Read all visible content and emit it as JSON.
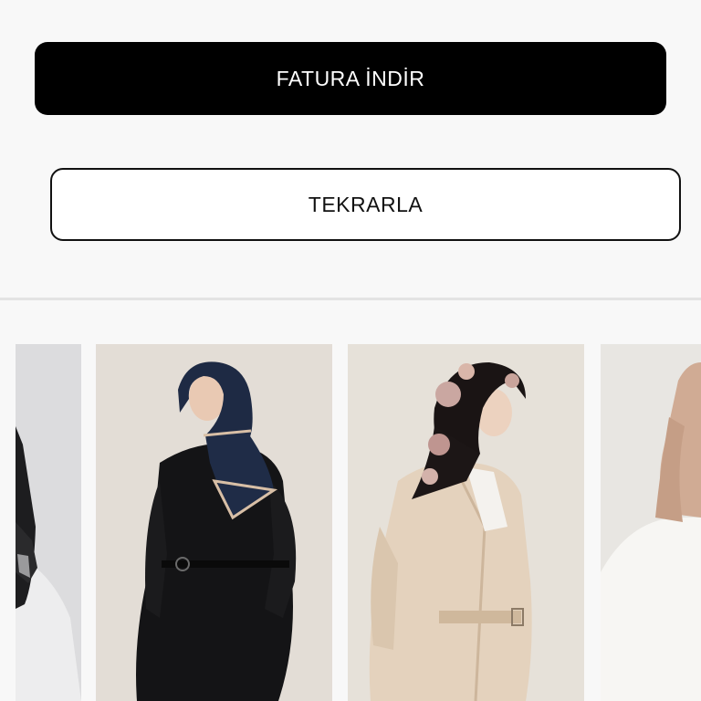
{
  "actions": {
    "download_invoice_label": "FATURA İNDİR",
    "repeat_order_label": "TEKRARLA"
  },
  "colors": {
    "primary_button": "#000000",
    "primary_text": "#ffffff",
    "secondary_border": "#111111",
    "page_background": "#f8f8f8",
    "divider": "#e3e3e3"
  },
  "products": [
    {
      "image": "hijab-scarf-partial-white-outfit"
    },
    {
      "image": "navy-scarf-black-coat-belt"
    },
    {
      "image": "floral-scarf-beige-coat-belt"
    },
    {
      "image": "satin-blush-scarf-white-outfit-partial"
    }
  ]
}
